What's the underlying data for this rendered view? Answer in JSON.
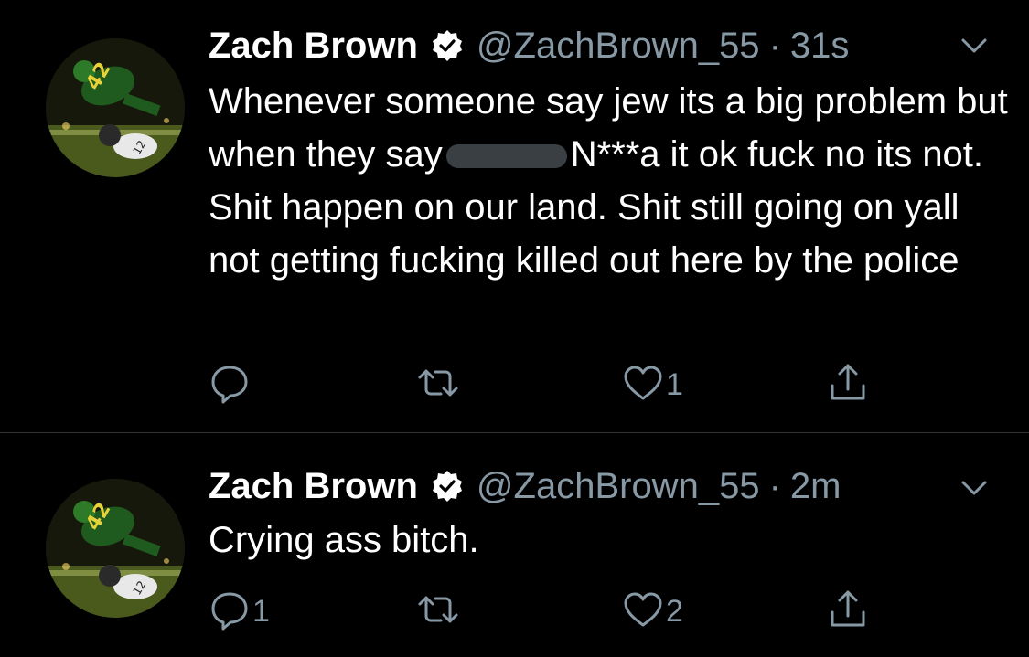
{
  "colors": {
    "background": "#000000",
    "text": "#ffffff",
    "secondary": "#8899a6",
    "divider": "#2f3336"
  },
  "tweets": [
    {
      "name": "Zach Brown",
      "handle": "@ZachBrown_55",
      "separator": "·",
      "time": "31s",
      "text_before": "Whenever someone say jew its a big problem but when they say",
      "text_after": "N***a it ok fuck no its not. Shit happen on our land. Shit still going on yall not getting fucking killed out here by the police",
      "reply_count": "",
      "retweet_count": "",
      "like_count": "1",
      "icons": {
        "reply": "reply-icon",
        "retweet": "retweet-icon",
        "like": "heart-icon",
        "share": "share-icon",
        "verified": "verified-badge-icon",
        "more": "chevron-down-icon"
      }
    },
    {
      "name": "Zach Brown",
      "handle": "@ZachBrown_55",
      "separator": "·",
      "time": "2m",
      "text": "Crying ass bitch.",
      "reply_count": "1",
      "retweet_count": "",
      "like_count": "2",
      "icons": {
        "reply": "reply-icon",
        "retweet": "retweet-icon",
        "like": "heart-icon",
        "share": "share-icon",
        "verified": "verified-badge-icon",
        "more": "chevron-down-icon"
      }
    }
  ]
}
